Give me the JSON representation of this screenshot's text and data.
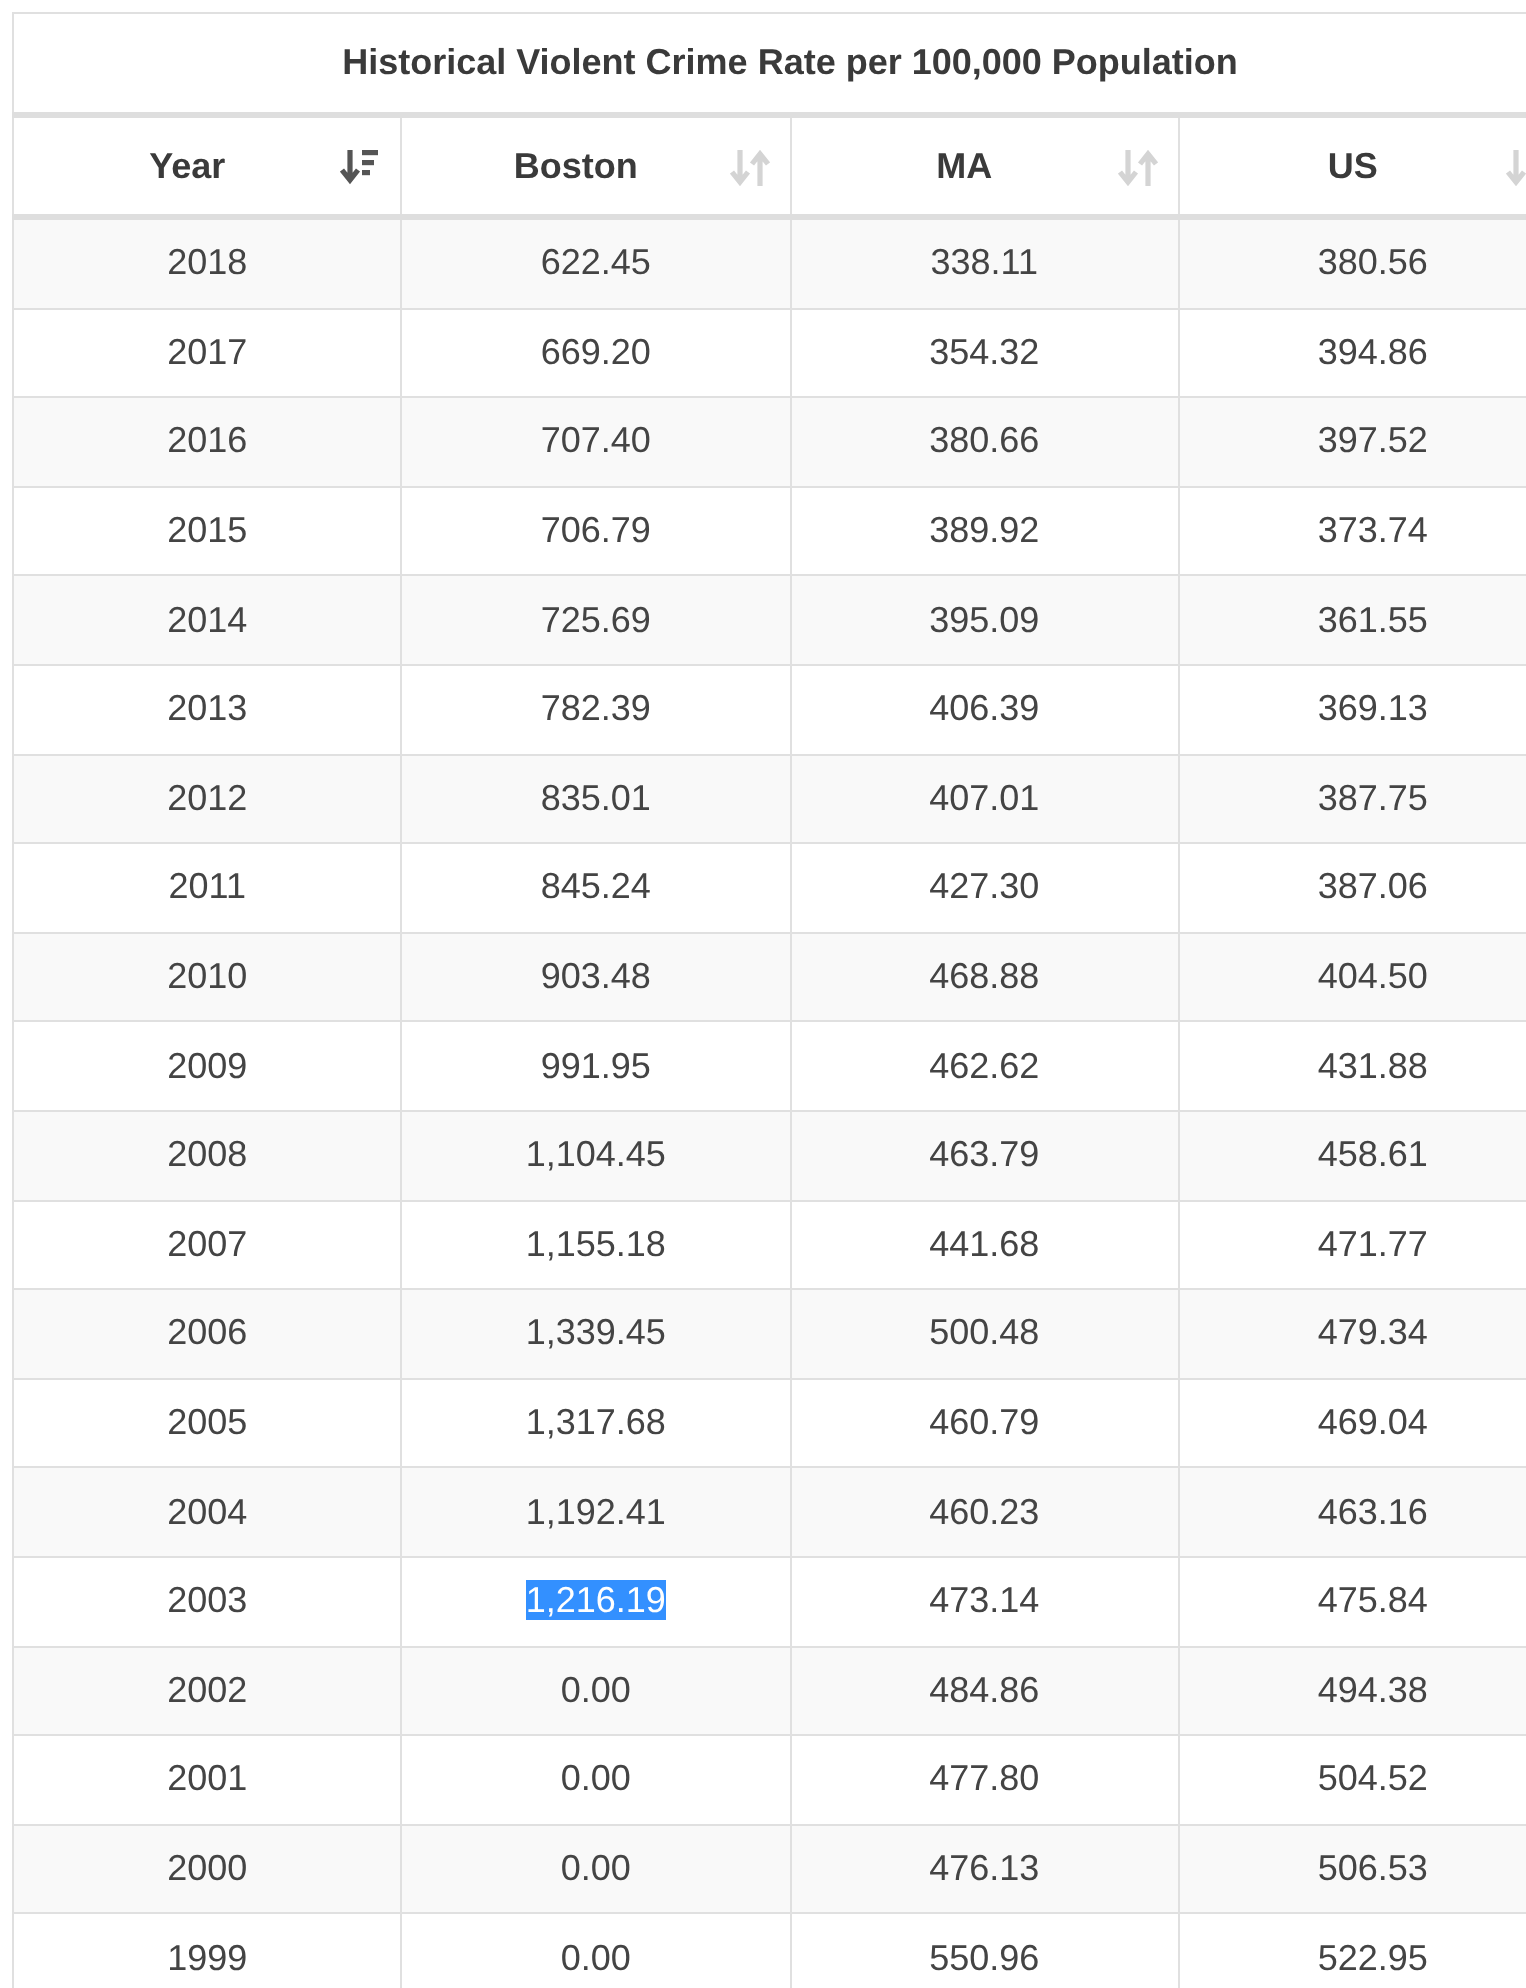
{
  "title": "Historical Violent Crime Rate per 100,000 Population",
  "columns": [
    {
      "label": "Year",
      "sorted": true
    },
    {
      "label": "Boston",
      "sorted": false
    },
    {
      "label": "MA",
      "sorted": false
    },
    {
      "label": "US",
      "sorted": false
    }
  ],
  "rows": [
    {
      "cells": [
        {
          "text": "2018",
          "selected": false
        },
        {
          "text": "622.45",
          "selected": false
        },
        {
          "text": "338.11",
          "selected": false
        },
        {
          "text": "380.56",
          "selected": false
        }
      ]
    },
    {
      "cells": [
        {
          "text": "2017",
          "selected": false
        },
        {
          "text": "669.20",
          "selected": false
        },
        {
          "text": "354.32",
          "selected": false
        },
        {
          "text": "394.86",
          "selected": false
        }
      ]
    },
    {
      "cells": [
        {
          "text": "2016",
          "selected": false
        },
        {
          "text": "707.40",
          "selected": false
        },
        {
          "text": "380.66",
          "selected": false
        },
        {
          "text": "397.52",
          "selected": false
        }
      ]
    },
    {
      "cells": [
        {
          "text": "2015",
          "selected": false
        },
        {
          "text": "706.79",
          "selected": false
        },
        {
          "text": "389.92",
          "selected": false
        },
        {
          "text": "373.74",
          "selected": false
        }
      ]
    },
    {
      "cells": [
        {
          "text": "2014",
          "selected": false
        },
        {
          "text": "725.69",
          "selected": false
        },
        {
          "text": "395.09",
          "selected": false
        },
        {
          "text": "361.55",
          "selected": false
        }
      ]
    },
    {
      "cells": [
        {
          "text": "2013",
          "selected": false
        },
        {
          "text": "782.39",
          "selected": false
        },
        {
          "text": "406.39",
          "selected": false
        },
        {
          "text": "369.13",
          "selected": false
        }
      ]
    },
    {
      "cells": [
        {
          "text": "2012",
          "selected": false
        },
        {
          "text": "835.01",
          "selected": false
        },
        {
          "text": "407.01",
          "selected": false
        },
        {
          "text": "387.75",
          "selected": false
        }
      ]
    },
    {
      "cells": [
        {
          "text": "2011",
          "selected": false
        },
        {
          "text": "845.24",
          "selected": false
        },
        {
          "text": "427.30",
          "selected": false
        },
        {
          "text": "387.06",
          "selected": false
        }
      ]
    },
    {
      "cells": [
        {
          "text": "2010",
          "selected": false
        },
        {
          "text": "903.48",
          "selected": false
        },
        {
          "text": "468.88",
          "selected": false
        },
        {
          "text": "404.50",
          "selected": false
        }
      ]
    },
    {
      "cells": [
        {
          "text": "2009",
          "selected": false
        },
        {
          "text": "991.95",
          "selected": false
        },
        {
          "text": "462.62",
          "selected": false
        },
        {
          "text": "431.88",
          "selected": false
        }
      ]
    },
    {
      "cells": [
        {
          "text": "2008",
          "selected": false
        },
        {
          "text": "1,104.45",
          "selected": false
        },
        {
          "text": "463.79",
          "selected": false
        },
        {
          "text": "458.61",
          "selected": false
        }
      ]
    },
    {
      "cells": [
        {
          "text": "2007",
          "selected": false
        },
        {
          "text": "1,155.18",
          "selected": false
        },
        {
          "text": "441.68",
          "selected": false
        },
        {
          "text": "471.77",
          "selected": false
        }
      ]
    },
    {
      "cells": [
        {
          "text": "2006",
          "selected": false
        },
        {
          "text": "1,339.45",
          "selected": false
        },
        {
          "text": "500.48",
          "selected": false
        },
        {
          "text": "479.34",
          "selected": false
        }
      ]
    },
    {
      "cells": [
        {
          "text": "2005",
          "selected": false
        },
        {
          "text": "1,317.68",
          "selected": false
        },
        {
          "text": "460.79",
          "selected": false
        },
        {
          "text": "469.04",
          "selected": false
        }
      ]
    },
    {
      "cells": [
        {
          "text": "2004",
          "selected": false
        },
        {
          "text": "1,192.41",
          "selected": false
        },
        {
          "text": "460.23",
          "selected": false
        },
        {
          "text": "463.16",
          "selected": false
        }
      ]
    },
    {
      "cells": [
        {
          "text": "2003",
          "selected": false
        },
        {
          "text": "1,216.19",
          "selected": true
        },
        {
          "text": "473.14",
          "selected": false
        },
        {
          "text": "475.84",
          "selected": false
        }
      ]
    },
    {
      "cells": [
        {
          "text": "2002",
          "selected": false
        },
        {
          "text": "0.00",
          "selected": false
        },
        {
          "text": "484.86",
          "selected": false
        },
        {
          "text": "494.38",
          "selected": false
        }
      ]
    },
    {
      "cells": [
        {
          "text": "2001",
          "selected": false
        },
        {
          "text": "0.00",
          "selected": false
        },
        {
          "text": "477.80",
          "selected": false
        },
        {
          "text": "504.52",
          "selected": false
        }
      ]
    },
    {
      "cells": [
        {
          "text": "2000",
          "selected": false
        },
        {
          "text": "0.00",
          "selected": false
        },
        {
          "text": "476.13",
          "selected": false
        },
        {
          "text": "506.53",
          "selected": false
        }
      ]
    },
    {
      "cells": [
        {
          "text": "1999",
          "selected": false
        },
        {
          "text": "0.00",
          "selected": false
        },
        {
          "text": "550.96",
          "selected": false
        },
        {
          "text": "522.95",
          "selected": false
        }
      ]
    }
  ]
}
